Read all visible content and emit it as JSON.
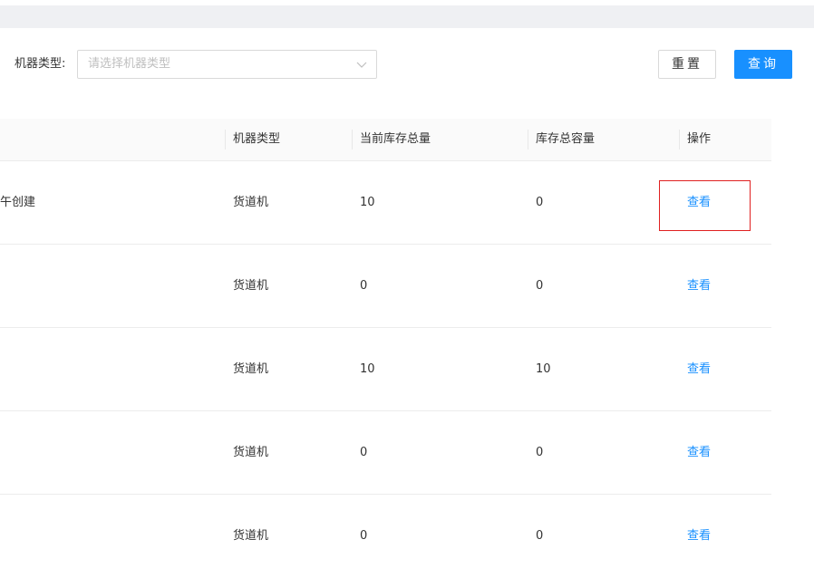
{
  "filter": {
    "machine_type_label": "机器类型:",
    "machine_type_placeholder": "请选择机器类型"
  },
  "buttons": {
    "reset": "重置",
    "query": "查询"
  },
  "table": {
    "columns": [
      "",
      "机器类型",
      "当前库存总量",
      "库存总容量",
      "操作"
    ],
    "rows": [
      {
        "name": "午创建",
        "machine_type": "货道机",
        "current_stock": "10",
        "total_capacity": "0",
        "action": "查看"
      },
      {
        "name": "",
        "machine_type": "货道机",
        "current_stock": "0",
        "total_capacity": "0",
        "action": "查看"
      },
      {
        "name": "",
        "machine_type": "货道机",
        "current_stock": "10",
        "total_capacity": "10",
        "action": "查看"
      },
      {
        "name": "",
        "machine_type": "货道机",
        "current_stock": "0",
        "total_capacity": "0",
        "action": "查看"
      },
      {
        "name": "",
        "machine_type": "货道机",
        "current_stock": "0",
        "total_capacity": "0",
        "action": "查看"
      }
    ]
  },
  "colors": {
    "primary": "#1890ff",
    "highlight_border": "#e02020"
  },
  "icons": {
    "select_arrow": "chevron-down-icon"
  }
}
